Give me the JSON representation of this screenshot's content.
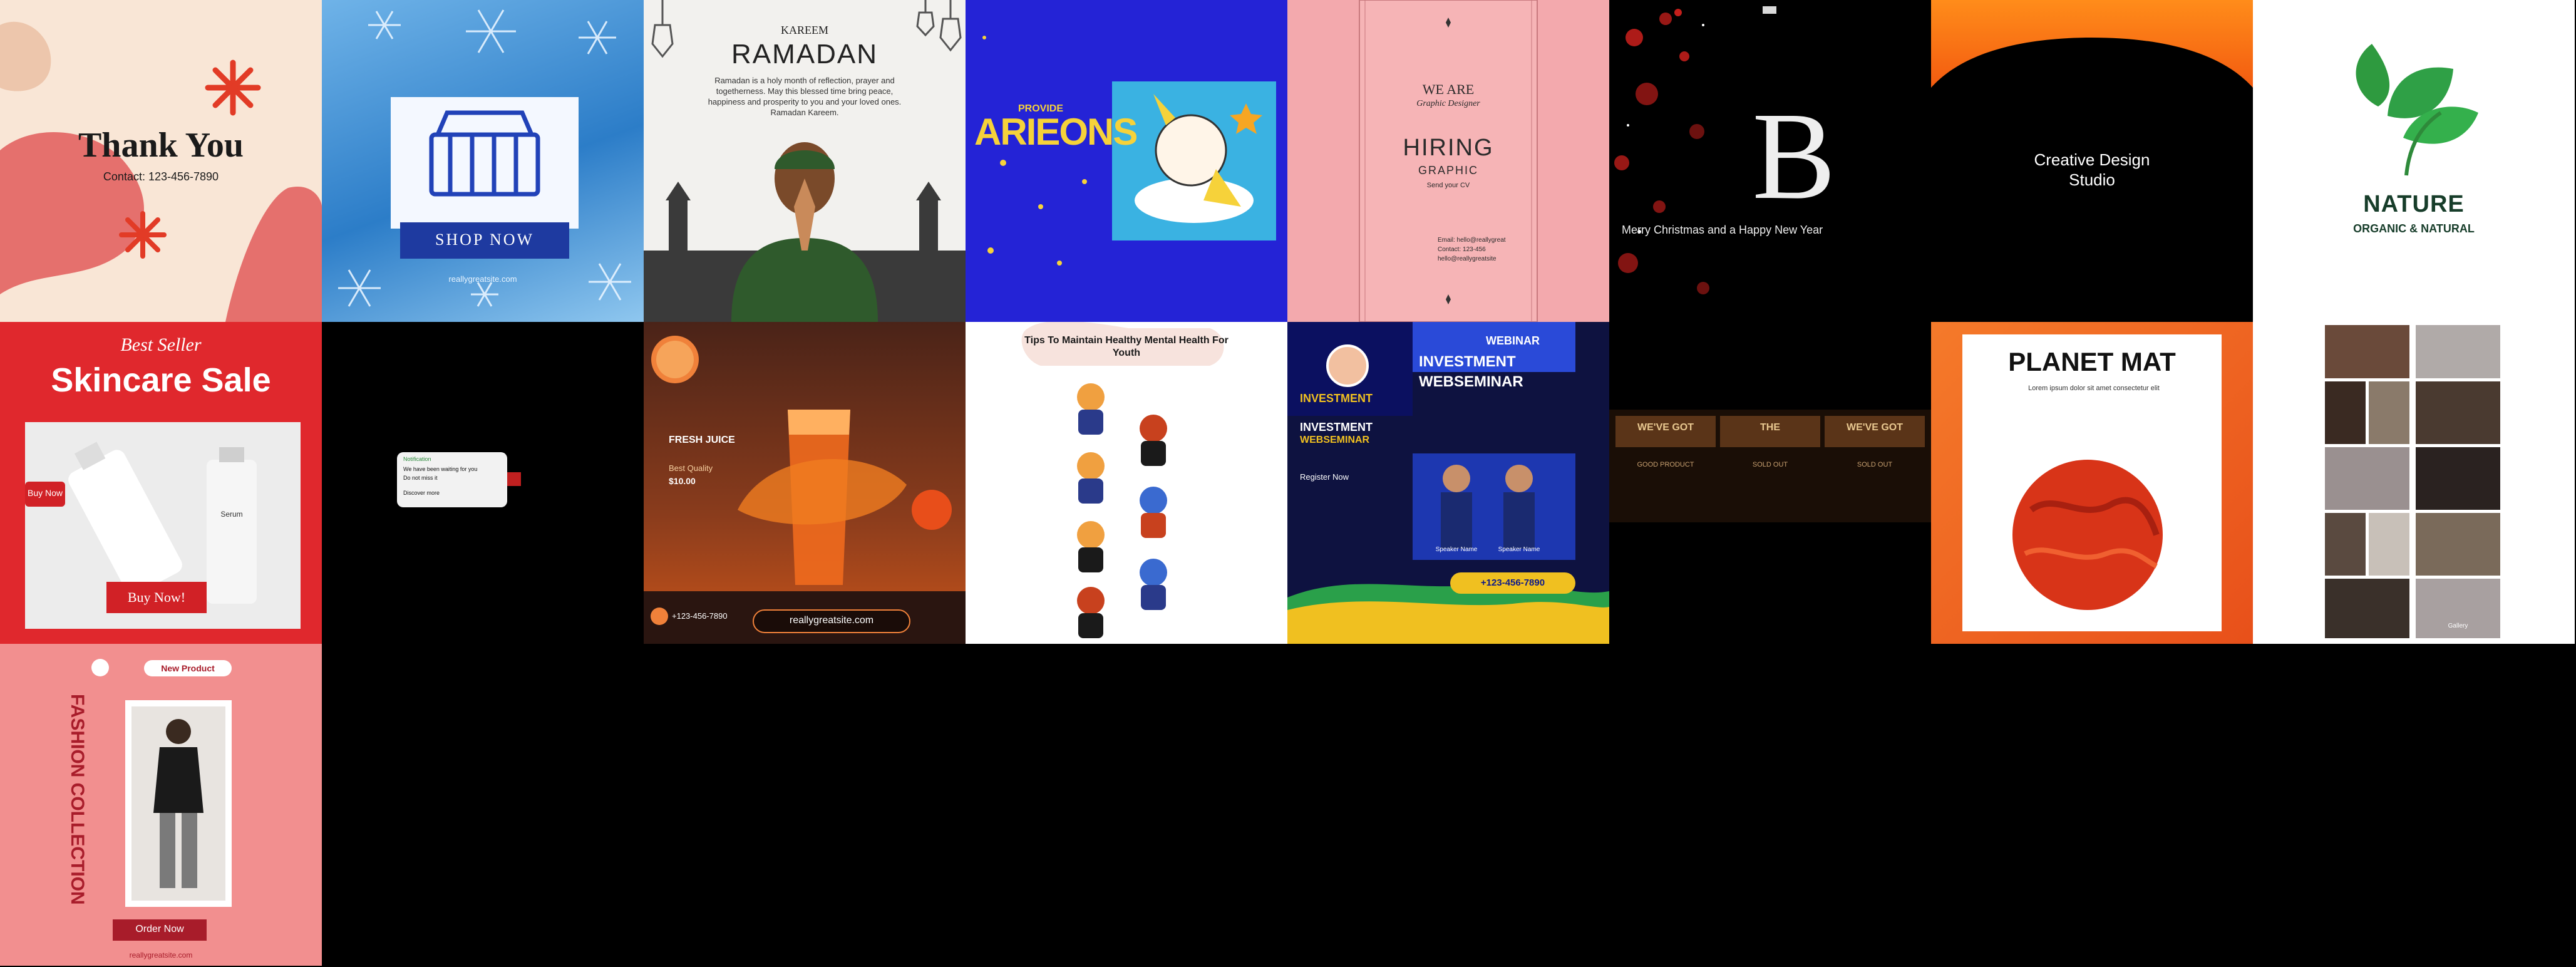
{
  "tiles": [
    {
      "thank": {
        "title": "Thank You",
        "contact": "Contact: 123-456-7890"
      }
    },
    {
      "winter": {
        "cta": "SHOP NOW",
        "site": "reallygreatsite.com"
      }
    },
    {
      "ramadan": {
        "kicker": "RAMADAN",
        "title": "KAREEM",
        "body": "Ramadan is a holy month of reflection, prayer and togetherness. May this blessed time bring peace, happiness and prosperity to you and your loved ones. Ramadan Kareem."
      }
    },
    {
      "cartoon": {
        "kicker": "PROVIDE",
        "title": "ARIEONS"
      }
    },
    {
      "pink": {
        "top": "WE ARE",
        "script": "Graphic Designer",
        "title": "HIRING",
        "subtitle": "GRAPHIC",
        "note": "Send your CV",
        "contact": "Email: hello@reallygreat",
        "phone": "Contact: 123-456",
        "site": "hello@reallygreatsite"
      }
    },
    {
      "xmas": {
        "monogram": "B",
        "greeting": "Merry Christmas and a Happy New Year"
      }
    },
    {
      "studio": {
        "line1": "Creative Design",
        "line2": "Studio"
      }
    },
    {
      "nature": {
        "brand": "NATURE",
        "tagline": "ORGANIC & NATURAL"
      }
    },
    {
      "skin": {
        "script": "Best Seller",
        "title": "Skincare Sale",
        "side": "Buy Now",
        "cta": "Buy Now!",
        "bottle_label": "Serum"
      }
    },
    {
      "dark": {
        "header": "Notification",
        "line1": "We have been waiting for you",
        "line2": "Do not miss it",
        "footer": "Discover more"
      }
    },
    {
      "juice": {
        "badge": "FRESH JUICE",
        "tag": "Best Quality",
        "price": "$10.00",
        "url": "reallygreatsite.com",
        "phone": "+123-456-7890"
      }
    },
    {
      "tips": {
        "title": "Tips To Maintain Healthy Mental Health For Youth"
      }
    },
    {
      "webinar": {
        "banner": "WEBINAR",
        "t1": "INVESTMENT",
        "t2": "WEBSEMINAR",
        "t3": "INVESTMENT",
        "t4": "INVESTMENT",
        "t5": "WEBSEMINAR",
        "speaker1": "Speaker Name",
        "speaker2": "Speaker Name",
        "info": "Register Now",
        "phone": "+123-456-7890"
      }
    },
    {
      "wood": {
        "panels": [
          "WE'VE GOT",
          "THE",
          "WE'VE GOT"
        ],
        "subs": [
          "GOOD PRODUCT",
          "SOLD OUT",
          "SOLD OUT"
        ]
      }
    },
    {
      "planet": {
        "title": "PLANET MAT",
        "subtitle": "Lorem ipsum dolor sit amet consectetur elit"
      }
    },
    {
      "collage": {
        "caption": "Gallery"
      }
    },
    {
      "fashion": {
        "badge": "New Product",
        "vertical": "FASHION COLLECTION",
        "cta": "Order Now",
        "site": "reallygreatsite.com"
      }
    }
  ],
  "colors": {
    "bg": "#000000",
    "salmon": "#e97468",
    "royal": "#2423d6",
    "pink": "#f3a9ad",
    "red": "#d9262b",
    "orange": "#f0641d",
    "green": "#2ea04a",
    "navy": "#0d1a8a"
  }
}
